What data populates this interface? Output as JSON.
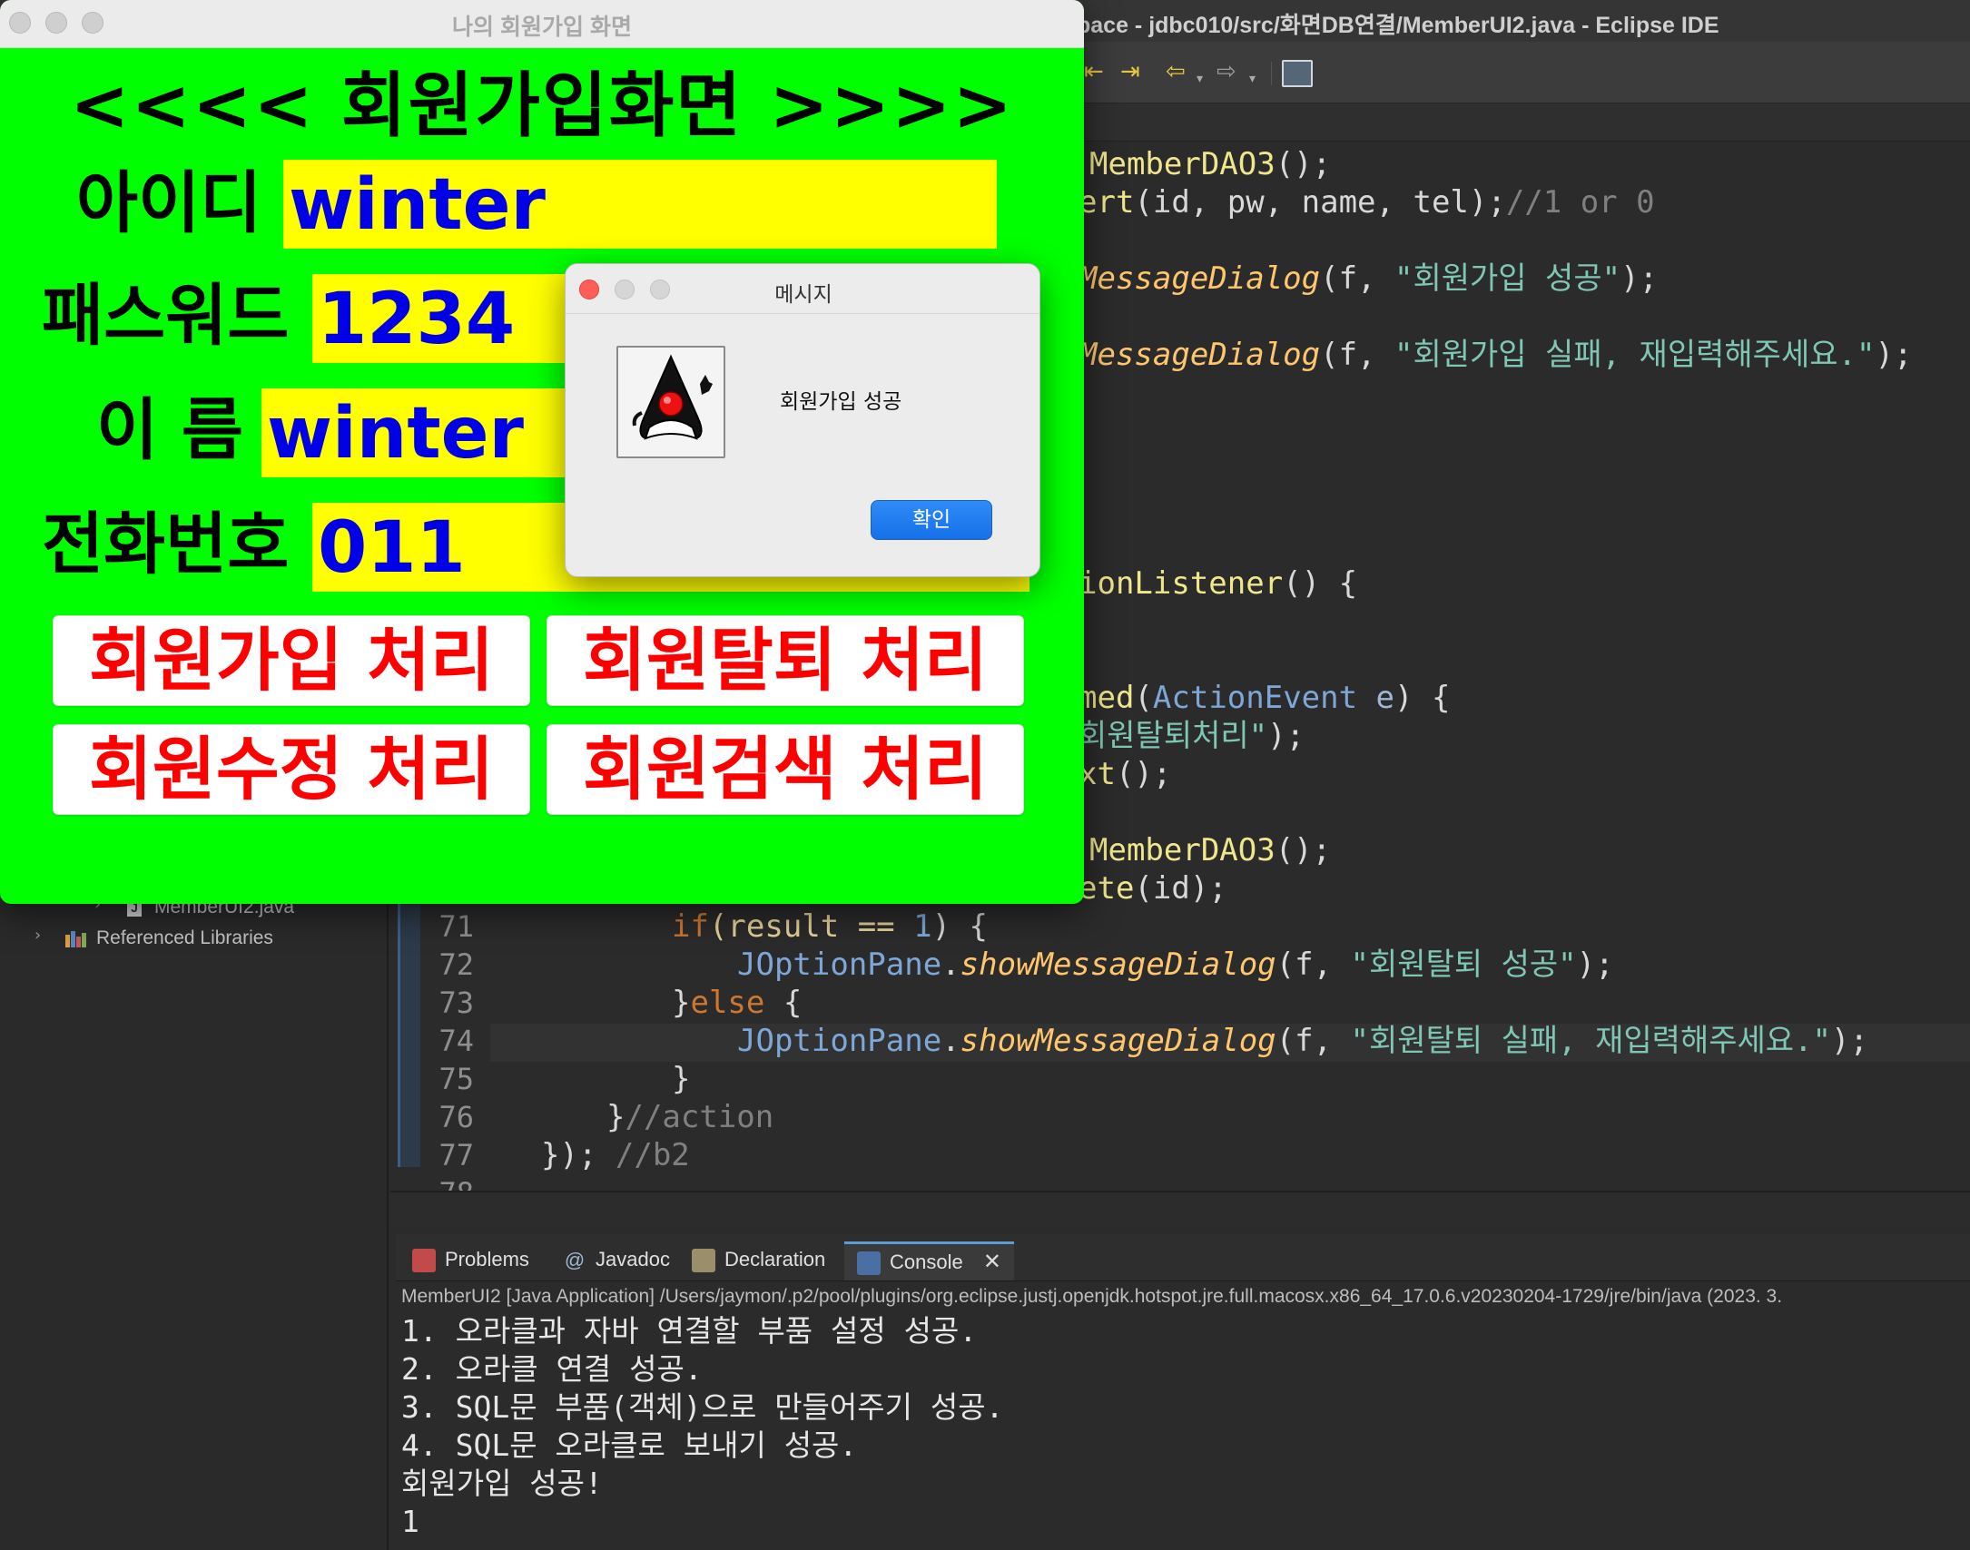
{
  "eclipse": {
    "title": "pace - jdbc010/src/화면DB연결/MemberUI2.java - Eclipse IDE",
    "tree": {
      "file": "MemberUI2.java",
      "libraries": "Referenced Libraries"
    },
    "code": {
      "partial_lines": [
        {
          "segments": [
            {
              "t": "MemberDAO3",
              "c": "c-yellow"
            },
            {
              "t": "();",
              "c": "c-plain"
            }
          ]
        },
        {
          "segments": [
            {
              "t": "ert",
              "c": "c-yellow"
            },
            {
              "t": "(id, pw, name, tel);",
              "c": "c-plain"
            },
            {
              "t": "//1 or 0",
              "c": "c-cmt"
            }
          ]
        },
        {
          "segments": [
            {
              "t": "MessageDialog",
              "c": "c-method"
            },
            {
              "t": "(f, ",
              "c": "c-plain"
            },
            {
              "t": "\"회원가입 성공\"",
              "c": "c-str"
            },
            {
              "t": ");",
              "c": "c-plain"
            }
          ]
        },
        {
          "segments": [
            {
              "t": "MessageDialog",
              "c": "c-method"
            },
            {
              "t": "(f, ",
              "c": "c-plain"
            },
            {
              "t": "\"회원가입 실패, 재입력해주세요.\"",
              "c": "c-str"
            },
            {
              "t": ");",
              "c": "c-plain"
            }
          ]
        },
        {
          "segments": [
            {
              "t": "ionListener",
              "c": "c-yellow"
            },
            {
              "t": "() {",
              "c": "c-plain"
            }
          ]
        },
        {
          "segments": [
            {
              "t": "med",
              "c": "c-yellow"
            },
            {
              "t": "(",
              "c": "c-plain"
            },
            {
              "t": "ActionEvent",
              "c": "c-type"
            },
            {
              "t": " e",
              "c": "c-param"
            },
            {
              "t": ") {",
              "c": "c-plain"
            }
          ]
        },
        {
          "segments": [
            {
              "t": "회원탈퇴처리\"",
              "c": "c-str"
            },
            {
              "t": ");",
              "c": "c-plain"
            }
          ]
        },
        {
          "segments": [
            {
              "t": "xt",
              "c": "c-yellow"
            },
            {
              "t": "();",
              "c": "c-plain"
            }
          ]
        },
        {
          "segments": [
            {
              "t": "MemberDAO3",
              "c": "c-yellow"
            },
            {
              "t": "();",
              "c": "c-plain"
            }
          ]
        },
        {
          "segments": [
            {
              "t": "ete",
              "c": "c-yellow"
            },
            {
              "t": "(id);",
              "c": "c-plain"
            }
          ]
        }
      ],
      "numbered_lines": [
        {
          "num": "71",
          "indent": 4,
          "segments": [
            {
              "t": "if",
              "c": "c-kw"
            },
            {
              "t": "(result == ",
              "c": "c-var"
            },
            {
              "t": "1",
              "c": "c-num"
            },
            {
              "t": ") {",
              "c": "c-plain"
            }
          ]
        },
        {
          "num": "72",
          "indent": 5,
          "segments": [
            {
              "t": "JOptionPane",
              "c": "c-type"
            },
            {
              "t": ".",
              "c": "c-plain"
            },
            {
              "t": "showMessageDialog",
              "c": "c-method"
            },
            {
              "t": "(f, ",
              "c": "c-plain"
            },
            {
              "t": "\"회원탈퇴 성공\"",
              "c": "c-str"
            },
            {
              "t": ");",
              "c": "c-plain"
            }
          ]
        },
        {
          "num": "73",
          "indent": 4,
          "segments": [
            {
              "t": "}",
              "c": "c-plain"
            },
            {
              "t": "else",
              "c": "c-kw"
            },
            {
              "t": " {",
              "c": "c-plain"
            }
          ]
        },
        {
          "num": "74",
          "indent": 5,
          "segments": [
            {
              "t": "JOptionPane",
              "c": "c-type"
            },
            {
              "t": ".",
              "c": "c-plain"
            },
            {
              "t": "showMessageDialog",
              "c": "c-method"
            },
            {
              "t": "(f, ",
              "c": "c-plain"
            },
            {
              "t": "\"회원탈퇴 실패, 재입력해주세요.\"",
              "c": "c-str"
            },
            {
              "t": ");",
              "c": "c-plain"
            }
          ]
        },
        {
          "num": "75",
          "indent": 4,
          "segments": [
            {
              "t": "}",
              "c": "c-plain"
            }
          ]
        },
        {
          "num": "76",
          "indent": 3,
          "segments": [
            {
              "t": "}",
              "c": "c-plain"
            },
            {
              "t": "//action",
              "c": "c-cmt"
            }
          ]
        },
        {
          "num": "77",
          "indent": 2,
          "segments": [
            {
              "t": "}); ",
              "c": "c-plain"
            },
            {
              "t": "//b2",
              "c": "c-cmt"
            }
          ]
        },
        {
          "num": "78",
          "indent": 0,
          "segments": []
        }
      ]
    },
    "console": {
      "tabs": [
        "Problems",
        "Javadoc",
        "Declaration",
        "Console"
      ],
      "active_tab": "Console",
      "path": "MemberUI2 [Java Application] /Users/jaymon/.p2/pool/plugins/org.eclipse.justj.openjdk.hotspot.jre.full.macosx.x86_64_17.0.6.v20230204-1729/jre/bin/java  (2023. 3.",
      "lines": [
        "1. 오라클과 자바 연결할 부품 설정 성공.",
        "2. 오라클 연결 성공.",
        "3. SQL문 부품(객체)으로 만들어주기 성공.",
        "4. SQL문 오라클로 보내기 성공.",
        "회원가입 성공!",
        "1"
      ]
    }
  },
  "member_window": {
    "title": "나의 회원가입 화면",
    "heading": "<<<< 회원가입화면 >>>>",
    "fields": {
      "id_label": "아이디",
      "id_value": "winter",
      "pw_label": "패스워드",
      "pw_value": "1234",
      "name_label": "이 름",
      "name_value": "winter",
      "tel_label": "전화번호",
      "tel_value": "011"
    },
    "buttons": {
      "join": "회원가입 처리",
      "delete": "회원탈퇴 처리",
      "update": "회원수정 처리",
      "search": "회원검색 처리"
    },
    "colors": {
      "background": "#00ff00",
      "field_bg": "#ffff00",
      "field_text": "#0000e6",
      "button_text": "#ff0000"
    }
  },
  "dialog": {
    "title": "메시지",
    "message": "회원가입 성공",
    "ok_label": "확인"
  }
}
